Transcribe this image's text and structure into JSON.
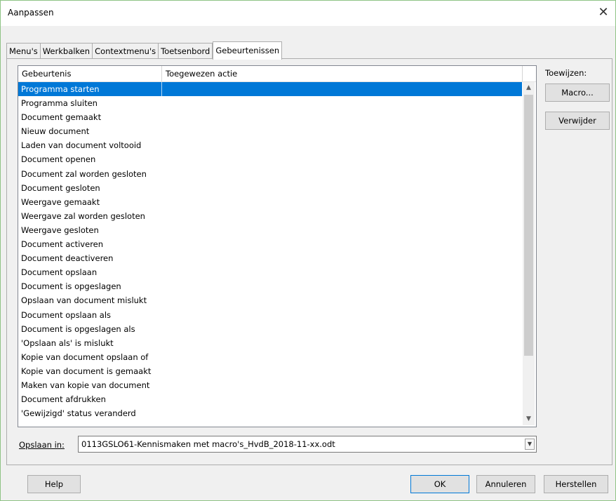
{
  "window": {
    "title": "Aanpassen",
    "close_glyph": "✕"
  },
  "tabs": [
    {
      "label": "Menu's",
      "active": false
    },
    {
      "label": "Werkbalken",
      "active": false
    },
    {
      "label": "Contextmenu's",
      "active": false
    },
    {
      "label": "Toetsenbord",
      "active": false
    },
    {
      "label": "Gebeurtenissen",
      "active": true
    }
  ],
  "events_list": {
    "columns": [
      "Gebeurtenis",
      "Toegewezen actie"
    ],
    "selected_index": 0,
    "rows": [
      "Programma starten",
      "Programma sluiten",
      "Document gemaakt",
      "Nieuw document",
      "Laden van document voltooid",
      "Document openen",
      "Document zal worden gesloten",
      "Document gesloten",
      "Weergave gemaakt",
      "Weergave zal worden gesloten",
      "Weergave gesloten",
      "Document activeren",
      "Document deactiveren",
      "Document opslaan",
      "Document is opgeslagen",
      "Opslaan van document mislukt",
      "Document opslaan als",
      "Document is opgeslagen als",
      "'Opslaan als' is mislukt",
      "Kopie van document opslaan of",
      "Kopie van document is gemaakt",
      "Maken van kopie van document",
      "Document afdrukken",
      "'Gewijzigd' status veranderd"
    ],
    "scroll_up_glyph": "▲",
    "scroll_down_glyph": "▼"
  },
  "assign": {
    "label": "Toewijzen:",
    "macro_button": "Macro...",
    "remove_button": "Verwijder"
  },
  "save_in": {
    "label": "Opslaan in:",
    "value": "0113GSLO61-Kennismaken met macro's_HvdB_2018-11-xx.odt",
    "dropdown_glyph": "▼"
  },
  "footer": {
    "help_button": "Help",
    "ok_button": "OK",
    "cancel_button": "Annuleren",
    "reset_button": "Herstellen"
  }
}
